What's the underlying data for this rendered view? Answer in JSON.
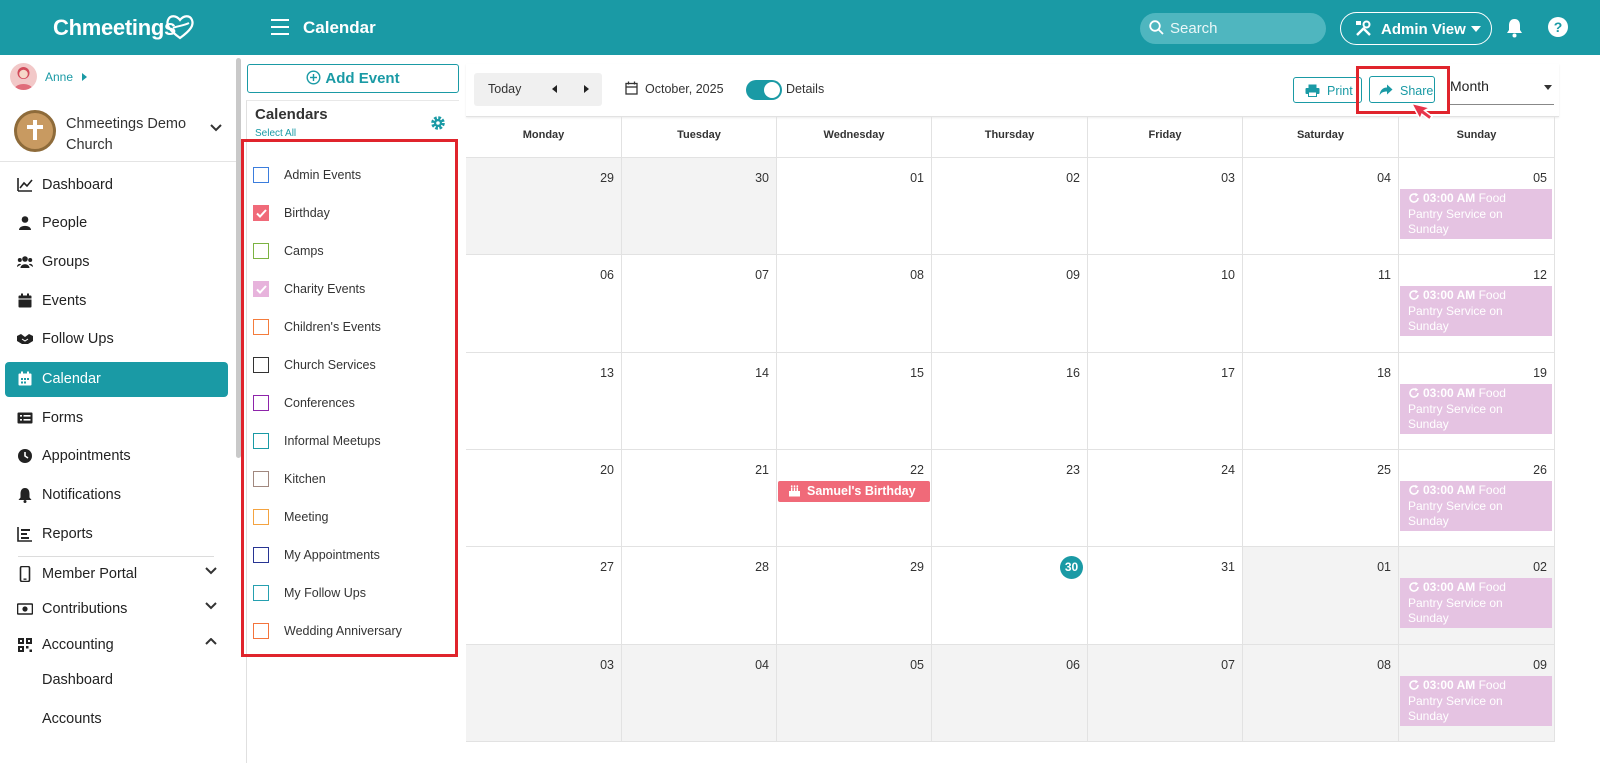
{
  "app": {
    "brand": "Chmeetings",
    "page_title": "Calendar",
    "search_placeholder": "Search",
    "admin_view_label": "Admin View",
    "help_label": "?"
  },
  "user": {
    "name": "Anne"
  },
  "church": {
    "name_line1": "Chmeetings Demo",
    "name_line2": "Church"
  },
  "nav": [
    {
      "label": "Dashboard",
      "icon": "chart-line-icon"
    },
    {
      "label": "People",
      "icon": "person-icon"
    },
    {
      "label": "Groups",
      "icon": "users-icon"
    },
    {
      "label": "Events",
      "icon": "calendar-icon"
    },
    {
      "label": "Follow Ups",
      "icon": "handshake-icon"
    },
    {
      "label": "Calendar",
      "icon": "calendar-grid-icon",
      "active": true
    },
    {
      "label": "Forms",
      "icon": "form-icon"
    },
    {
      "label": "Appointments",
      "icon": "clock-icon"
    },
    {
      "label": "Notifications",
      "icon": "bell-icon"
    },
    {
      "label": "Reports",
      "icon": "bar-list-icon"
    },
    {
      "label": "Member Portal",
      "icon": "mobile-icon",
      "chevron": "down"
    },
    {
      "label": "Contributions",
      "icon": "money-icon",
      "chevron": "down"
    },
    {
      "label": "Accounting",
      "icon": "qr-icon",
      "chevron": "up"
    }
  ],
  "accounting_sub": [
    "Dashboard",
    "Accounts"
  ],
  "calendars_panel": {
    "add_event": "Add Event",
    "title": "Calendars",
    "select_all": "Select All",
    "items": [
      {
        "label": "Admin Events",
        "color": "#3b7ddd",
        "checked": false
      },
      {
        "label": "Birthday",
        "color": "#f06a79",
        "checked": true
      },
      {
        "label": "Camps",
        "color": "#7cb342",
        "checked": false
      },
      {
        "label": "Charity Events",
        "color": "#e7b3dc",
        "checked": true
      },
      {
        "label": "Children's Events",
        "color": "#f47c3c",
        "checked": false
      },
      {
        "label": "Church Services",
        "color": "#333333",
        "checked": false
      },
      {
        "label": "Conferences",
        "color": "#8e24aa",
        "checked": false
      },
      {
        "label": "Informal Meetups",
        "color": "#1a9aa5",
        "checked": false
      },
      {
        "label": "Kitchen",
        "color": "#a1887f",
        "checked": false
      },
      {
        "label": "Meeting",
        "color": "#f4a340",
        "checked": false
      },
      {
        "label": "My Appointments",
        "color": "#283593",
        "checked": false
      },
      {
        "label": "My Follow Ups",
        "color": "#26a0b0",
        "checked": false
      },
      {
        "label": "Wedding Anniversary",
        "color": "#f4743c",
        "checked": false
      }
    ]
  },
  "toolbar": {
    "today": "Today",
    "month_label": "October, 2025",
    "details_label": "Details",
    "details_on": true,
    "print": "Print",
    "share": "Share",
    "view": "Month"
  },
  "calendar": {
    "weekdays": [
      "Monday",
      "Tuesday",
      "Wednesday",
      "Thursday",
      "Friday",
      "Saturday",
      "Sunday"
    ],
    "weeks": [
      [
        "29",
        "30",
        "01",
        "02",
        "03",
        "04",
        "05"
      ],
      [
        "06",
        "07",
        "08",
        "09",
        "10",
        "11",
        "12"
      ],
      [
        "13",
        "14",
        "15",
        "16",
        "17",
        "18",
        "19"
      ],
      [
        "20",
        "21",
        "22",
        "23",
        "24",
        "25",
        "26"
      ],
      [
        "27",
        "28",
        "29",
        "30",
        "31",
        "01",
        "02"
      ],
      [
        "03",
        "04",
        "05",
        "06",
        "07",
        "08",
        "09"
      ]
    ],
    "other_month": [
      [
        0,
        0
      ],
      [
        0,
        1
      ],
      [
        4,
        5
      ],
      [
        4,
        6
      ],
      [
        5,
        0
      ],
      [
        5,
        1
      ],
      [
        5,
        2
      ],
      [
        5,
        3
      ],
      [
        5,
        4
      ],
      [
        5,
        5
      ],
      [
        5,
        6
      ]
    ],
    "today": [
      4,
      3
    ],
    "food_event": {
      "time": "03:00 AM",
      "title_line1": "Food",
      "title_line2": "Pantry Service on",
      "title_line3": "Sunday"
    },
    "birthday_event": {
      "title": "Samuel's Birthday",
      "week": 3,
      "day": 2
    },
    "colors": {
      "accent": "#1a9aa5",
      "food_event_bg": "#e5c3e2",
      "birthday_bg": "#f06a79",
      "highlight": "#e0242c"
    }
  }
}
